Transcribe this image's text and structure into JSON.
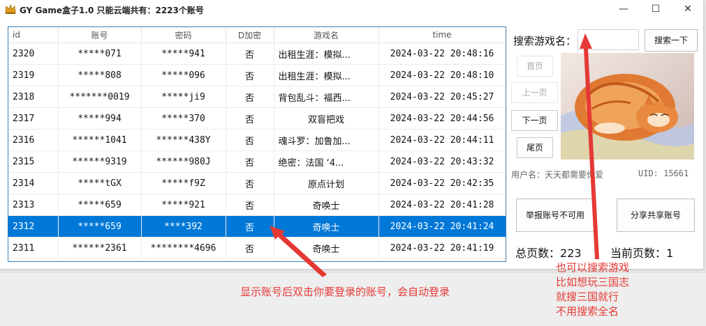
{
  "window": {
    "title": "GY Game盒子1.0    只能云端共有：2223个账号",
    "minimize": "—",
    "maximize": "☐",
    "close": "✕"
  },
  "table": {
    "columns": [
      "id",
      "账号",
      "密码",
      "D加密",
      "游戏名",
      "time"
    ],
    "rows": [
      {
        "id": "2320",
        "account": "*****071",
        "password": "*****941",
        "encrypted": "否",
        "game": "出租生涯：模拟...",
        "time": "2024-03-22 20:48:16",
        "selected": false
      },
      {
        "id": "2319",
        "account": "*****808",
        "password": "*****096",
        "encrypted": "否",
        "game": "出租生涯：模拟...",
        "time": "2024-03-22 20:48:10",
        "selected": false
      },
      {
        "id": "2318",
        "account": "*******0019",
        "password": "*****ji9",
        "encrypted": "否",
        "game": "背包乱斗：福西...",
        "time": "2024-03-22 20:45:27",
        "selected": false
      },
      {
        "id": "2317",
        "account": "*****994",
        "password": "*****370",
        "encrypted": "否",
        "game": "双盲把戏",
        "time": "2024-03-22 20:44:56",
        "selected": false
      },
      {
        "id": "2316",
        "account": "******1041",
        "password": "******438Y",
        "encrypted": "否",
        "game": "魂斗罗：加鲁加...",
        "time": "2024-03-22 20:44:11",
        "selected": false
      },
      {
        "id": "2315",
        "account": "******9319",
        "password": "******980J",
        "encrypted": "否",
        "game": "绝密：法国 ‘4...",
        "time": "2024-03-22 20:43:32",
        "selected": false
      },
      {
        "id": "2314",
        "account": "*****tGX",
        "password": "*****f9Z",
        "encrypted": "否",
        "game": "原点计划",
        "time": "2024-03-22 20:42:35",
        "selected": false
      },
      {
        "id": "2313",
        "account": "*****659",
        "password": "*****921",
        "encrypted": "否",
        "game": "奇唤士",
        "time": "2024-03-22 20:41:28",
        "selected": false
      },
      {
        "id": "2312",
        "account": "*****659",
        "password": "****392",
        "encrypted": "否",
        "game": "奇唤士",
        "time": "2024-03-22 20:41:24",
        "selected": true
      },
      {
        "id": "2311",
        "account": "******2361",
        "password": "********4696",
        "encrypted": "否",
        "game": "奇唤士",
        "time": "2024-03-22 20:41:19",
        "selected": false
      }
    ]
  },
  "search": {
    "label": "搜索游戏名：",
    "value": "",
    "button": "搜索一下"
  },
  "pager": {
    "first": "首页",
    "prev": "上一页",
    "next": "下一页",
    "last": "尾页",
    "total_label": "总页数：",
    "total_value": "223",
    "current_label": "当前页数：",
    "current_value": "1"
  },
  "user": {
    "name_label": "用户名：天天都需要你爱",
    "uid": "UID: 15661"
  },
  "actions": {
    "report": "举报账号不可用",
    "share": "分享共享账号"
  },
  "annotations": {
    "left": "显示账号后双击你要登录的账号，会自动登录",
    "right": [
      "也可以搜索游戏",
      "比如想玩三国志",
      "就搜三国就行",
      "不用搜索全名"
    ],
    "color": "#e53935"
  },
  "colors": {
    "selection": "#0078d7",
    "table_border": "#3c7fb1"
  }
}
